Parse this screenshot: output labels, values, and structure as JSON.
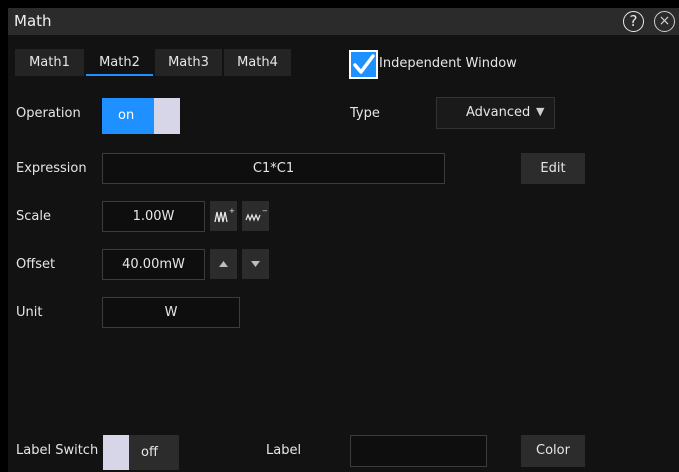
{
  "window": {
    "title": "Math"
  },
  "tabs": [
    {
      "label": "Math1"
    },
    {
      "label": "Math2"
    },
    {
      "label": "Math3"
    },
    {
      "label": "Math4"
    }
  ],
  "independent_window": {
    "label": "Independent Window",
    "checked": true
  },
  "operation": {
    "label": "Operation",
    "state": "on"
  },
  "type": {
    "label": "Type",
    "value": "Advanced"
  },
  "expression": {
    "label": "Expression",
    "value": "C1*C1",
    "edit_label": "Edit"
  },
  "scale": {
    "label": "Scale",
    "value": "1.00W"
  },
  "offset": {
    "label": "Offset",
    "value": "40.00mW"
  },
  "unit": {
    "label": "Unit",
    "value": "W"
  },
  "label_switch": {
    "label": "Label Switch",
    "state": "off"
  },
  "label_field": {
    "label": "Label",
    "value": ""
  },
  "color_button": {
    "label": "Color"
  },
  "colors": {
    "accent": "#1e90ff",
    "background": "#121212",
    "titlebar": "#2b2b2b",
    "control": "#2c2c2c"
  }
}
